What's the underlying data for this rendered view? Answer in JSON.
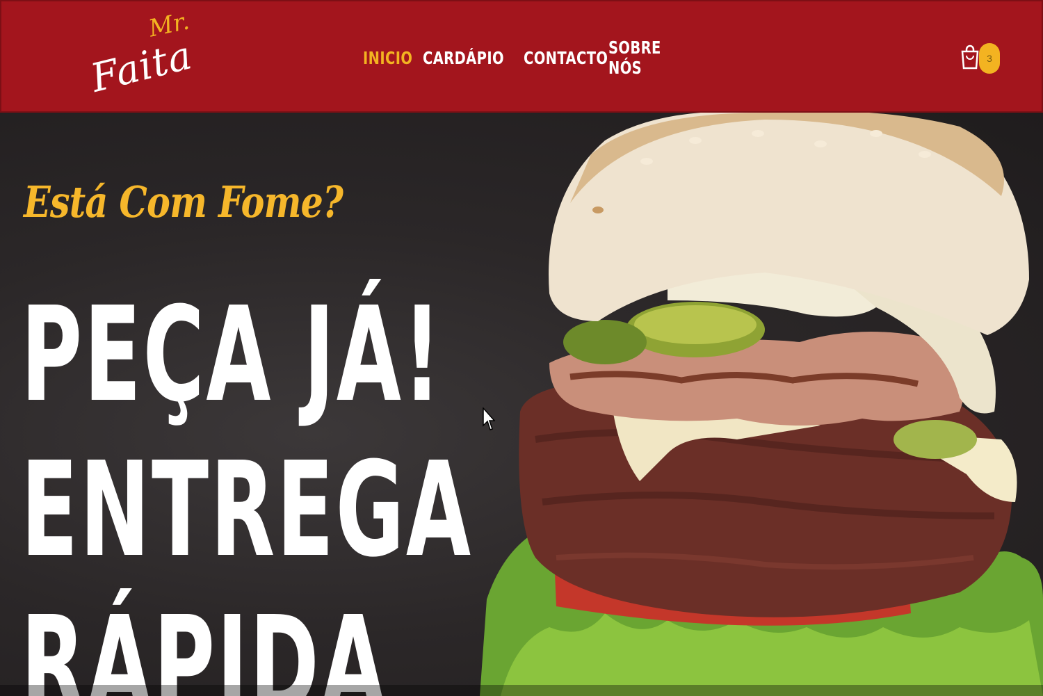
{
  "header": {
    "logo": {
      "line1": "Mr.",
      "line2": "Faita"
    },
    "nav": [
      {
        "label": "INICIO",
        "active": true
      },
      {
        "label": "CARDÁPIO",
        "has_dropdown": true
      },
      {
        "label": "CONTACTO"
      },
      {
        "label": "SOBRE NÓS"
      }
    ],
    "cart": {
      "icon": "shopping-bag-icon",
      "count": "3"
    }
  },
  "hero": {
    "tagline": "Está Com Fome?",
    "headline": [
      "PEÇA JÁ!",
      "ENTREGA",
      "RÁPIDA"
    ],
    "image": "burger-photo"
  },
  "colors": {
    "header_bg": "#a3151d",
    "accent": "#f3b321",
    "hero_bg": "#2b2728",
    "text": "#ffffff"
  }
}
